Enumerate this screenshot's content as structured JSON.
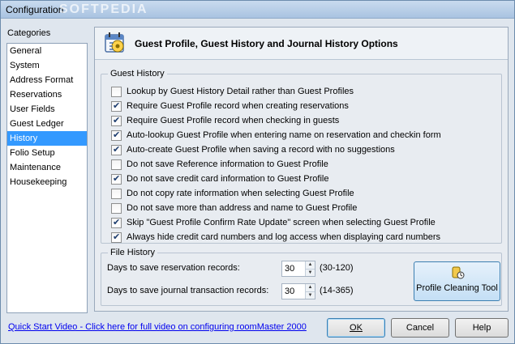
{
  "window": {
    "title": "Configuration",
    "watermark": "SOFTPEDIA"
  },
  "categories": {
    "label": "Categories",
    "items": [
      "General",
      "System",
      "Address Format",
      "Reservations",
      "User Fields",
      "Guest Ledger",
      "History",
      "Folio Setup",
      "Maintenance",
      "Housekeeping"
    ],
    "selected": "History"
  },
  "panel": {
    "title": "Guest Profile, Guest History and Journal History Options",
    "guest_history": {
      "legend": "Guest History",
      "options": [
        {
          "label": "Lookup by Guest History Detail rather than Guest Profiles",
          "checked": false
        },
        {
          "label": "Require Guest Profile record when creating reservations",
          "checked": true
        },
        {
          "label": "Require Guest Profile record when checking in guests",
          "checked": true
        },
        {
          "label": "Auto-lookup Guest Profile when entering name on reservation and checkin form",
          "checked": true
        },
        {
          "label": "Auto-create Guest Profile when saving a record with no suggestions",
          "checked": true
        },
        {
          "label": "Do not save Reference information to Guest Profile",
          "checked": false
        },
        {
          "label": "Do not save credit card information to Guest Profile",
          "checked": true
        },
        {
          "label": "Do not copy rate information when selecting Guest Profile",
          "checked": false
        },
        {
          "label": "Do not save more than address and name to Guest Profile",
          "checked": false
        },
        {
          "label": "Skip \"Guest Profile Confirm Rate Update\" screen when selecting Guest Profile",
          "checked": true
        },
        {
          "label": "Always hide credit card numbers and log access when displaying card numbers",
          "checked": true
        }
      ]
    },
    "file_history": {
      "legend": "File History",
      "reservation_label": "Days to save reservation records:",
      "reservation_value": "30",
      "reservation_range": "(30-120)",
      "journal_label": "Days to save journal transaction records:",
      "journal_value": "30",
      "journal_range": "(14-365)",
      "tool_button": "Profile Cleaning Tool"
    }
  },
  "footer": {
    "link": "Quick Start Video - Click here for full video on configuring roomMaster 2000",
    "ok": "OK",
    "cancel": "Cancel",
    "help": "Help"
  }
}
